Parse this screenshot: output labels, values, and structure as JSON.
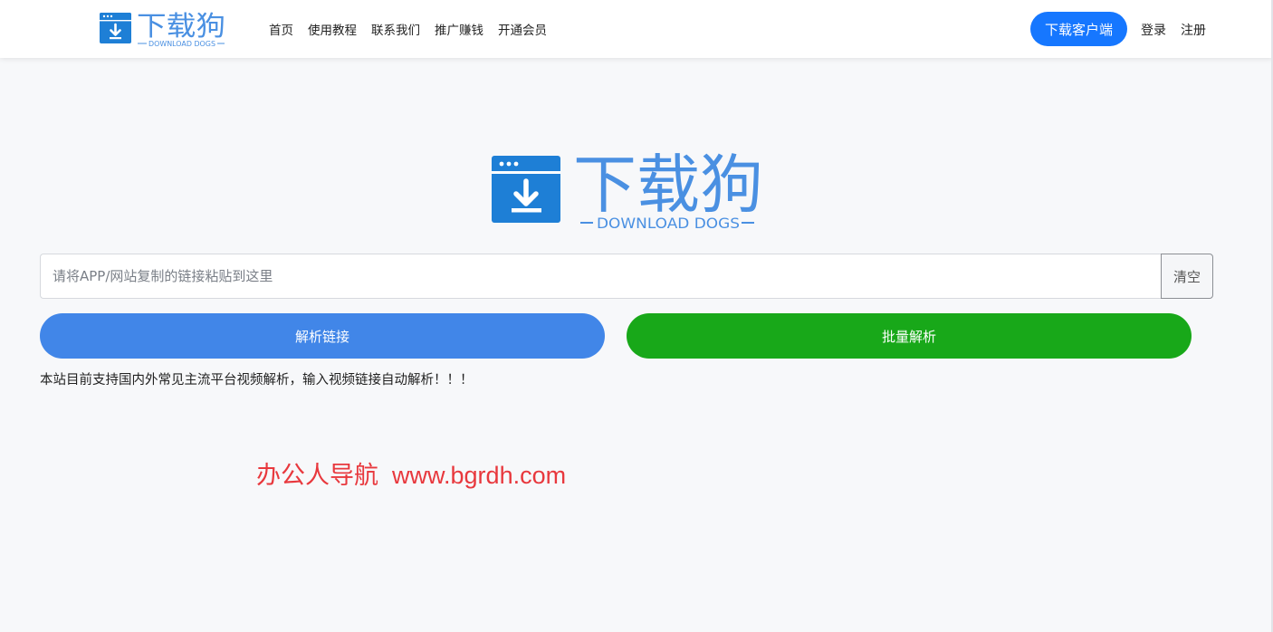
{
  "brand": {
    "name": "下载狗",
    "tagline": "DOWNLOAD DOGS",
    "icon": "download-window-icon",
    "color": "#1e7fd6",
    "text_color": "#4a90e2"
  },
  "nav": {
    "items": [
      "首页",
      "使用教程",
      "联系我们",
      "推广赚钱",
      "开通会员"
    ]
  },
  "header": {
    "download_client": "下载客户端",
    "login": "登录",
    "register": "注册",
    "accent": "#1677ff"
  },
  "search": {
    "placeholder": "请将APP/网站复制的链接粘贴到这里",
    "value": "",
    "clear_label": "清空"
  },
  "actions": {
    "parse_label": "解析链接",
    "parse_color": "#4186e8",
    "batch_label": "批量解析",
    "batch_color": "#18a819"
  },
  "notice": "本站目前支持国内外常见主流平台视频解析，输入视频链接自动解析！！！",
  "watermark": {
    "cn": "办公人导航",
    "url": "www.bgrdh.com",
    "color": "#e8383d"
  }
}
